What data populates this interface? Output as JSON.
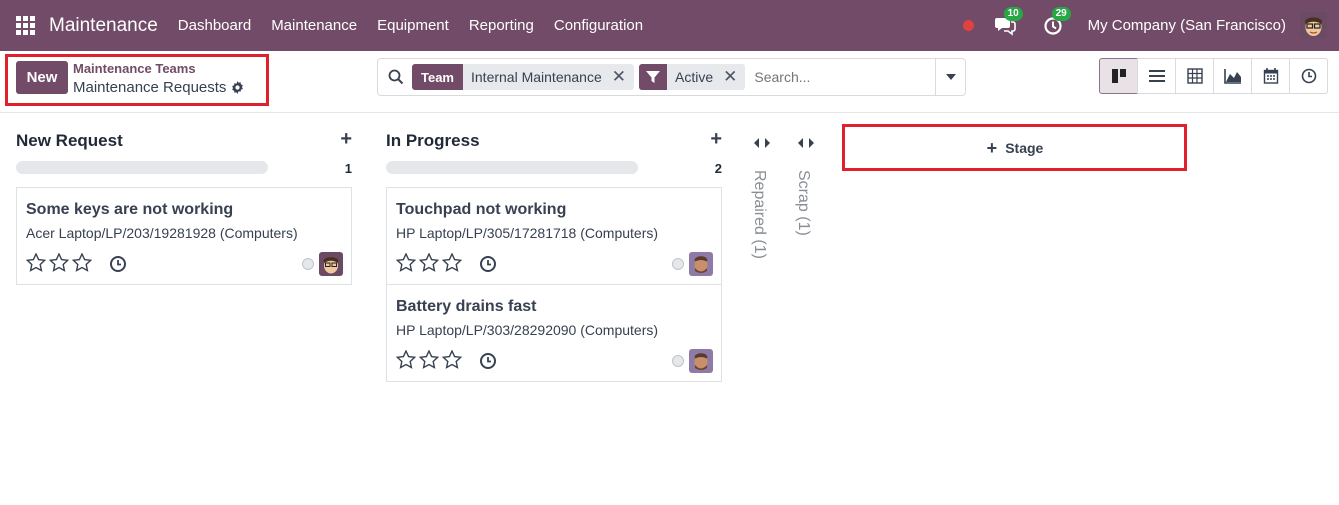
{
  "navbar": {
    "app_name": "Maintenance",
    "menu": [
      "Dashboard",
      "Maintenance",
      "Equipment",
      "Reporting",
      "Configuration"
    ],
    "messages_count": "10",
    "activities_count": "29",
    "company": "My Company (San Francisco)"
  },
  "control": {
    "new_label": "New",
    "breadcrumb_parent": "Maintenance Teams",
    "breadcrumb_current": "Maintenance Requests",
    "facets": [
      {
        "label": "Team",
        "value": "Internal Maintenance"
      },
      {
        "label": "filter-icon",
        "value": "Active"
      }
    ],
    "search_placeholder": "Search..."
  },
  "views": [
    "kanban",
    "list",
    "pivot",
    "graph",
    "calendar",
    "activity"
  ],
  "columns": [
    {
      "title": "New Request",
      "count": "1",
      "cards": [
        {
          "title": "Some keys are not working",
          "equipment": "Acer Laptop/LP/203/19281928 (Computers)"
        }
      ]
    },
    {
      "title": "In Progress",
      "count": "2",
      "cards": [
        {
          "title": "Touchpad not working",
          "equipment": "HP Laptop/LP/305/17281718 (Computers)"
        },
        {
          "title": "Battery drains fast",
          "equipment": "HP Laptop/LP/303/28292090 (Computers)"
        }
      ]
    }
  ],
  "folded_columns": [
    "Repaired (1)",
    "Scrap (1)"
  ],
  "stage_button": "Stage",
  "colors": {
    "brand": "#714b67",
    "highlight": "#e0202c",
    "badge": "#28a745",
    "red_dot": "#e24141"
  }
}
